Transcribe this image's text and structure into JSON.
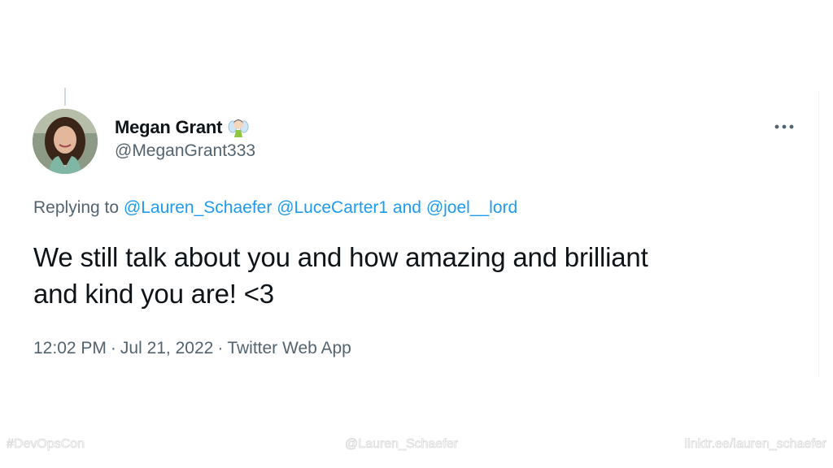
{
  "tweet": {
    "author": {
      "name": "Megan Grant",
      "handle": "@MeganGrant333",
      "avatar_icon": "profile-photo",
      "name_emoji": "fairy-emoji"
    },
    "reply_context": {
      "prefix": "Replying to",
      "mentions": [
        "@Lauren_Schaefer",
        "@LuceCarter1"
      ],
      "conjunction": "and",
      "last_mention": "@joel__lord"
    },
    "text_line1": "We still talk about you and how amazing and brilliant",
    "text_line2": "and kind you are! <3",
    "time": "12:02 PM",
    "date": "Jul 21, 2022",
    "source": "Twitter Web App",
    "separator": "·",
    "more_icon": "more-horizontal-icon"
  },
  "footer": {
    "hashtag": "#DevOpsCon",
    "handle": "@Lauren_Schaefer",
    "link": "linktr.ee/lauren_schaefer"
  },
  "colors": {
    "text_primary": "#0f1419",
    "text_secondary": "#536471",
    "link": "#1d9bf0"
  }
}
